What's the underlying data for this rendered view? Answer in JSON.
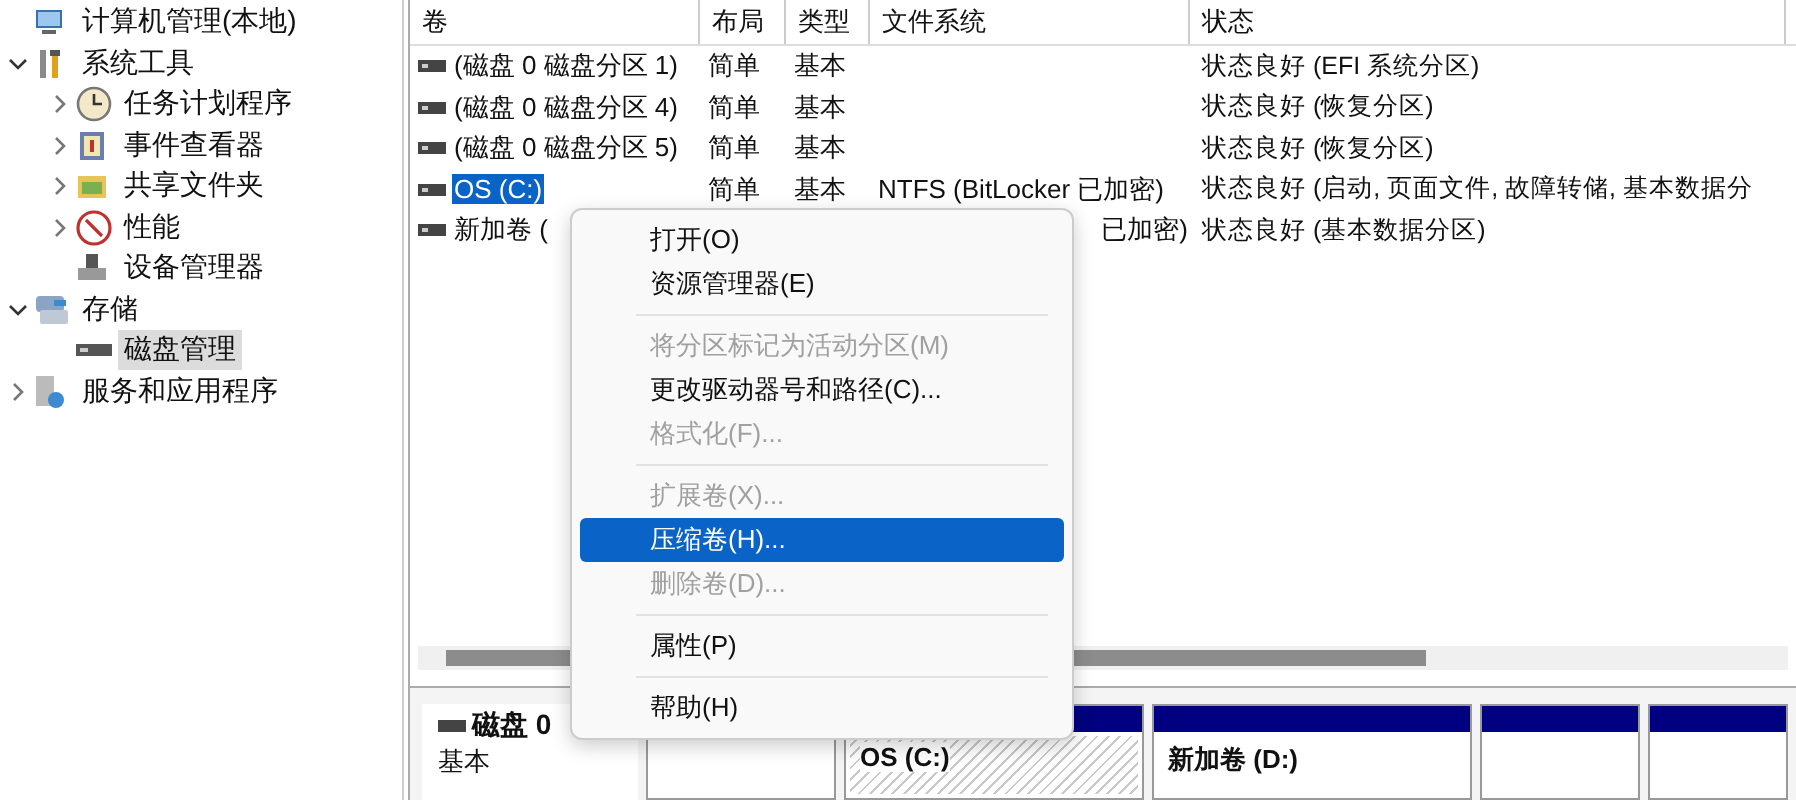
{
  "tree": [
    {
      "label": "计算机管理(本地)",
      "selected": false,
      "children": [
        {
          "label": "系统工具",
          "expanded": true,
          "selected": false,
          "children": [
            {
              "label": "任务计划程序",
              "expanded": false,
              "selected": false
            },
            {
              "label": "事件查看器",
              "expanded": false,
              "selected": false
            },
            {
              "label": "共享文件夹",
              "expanded": false,
              "selected": false
            },
            {
              "label": "性能",
              "expanded": false,
              "selected": false
            },
            {
              "label": "设备管理器",
              "selected": false
            }
          ]
        },
        {
          "label": "存储",
          "expanded": true,
          "selected": false,
          "children": [
            {
              "label": "磁盘管理",
              "selected": true
            }
          ]
        },
        {
          "label": "服务和应用程序",
          "expanded": false,
          "selected": false
        }
      ]
    }
  ],
  "table": {
    "columns": [
      "卷",
      "布局",
      "类型",
      "文件系统",
      "状态"
    ],
    "rows": [
      {
        "volume": "(磁盘 0 磁盘分区 1)",
        "layout": "简单",
        "type": "基本",
        "status": "状态良好 (EFI 系统分区)",
        "selected": false
      },
      {
        "volume": "(磁盘 0 磁盘分区 4)",
        "layout": "简单",
        "type": "基本",
        "status": "状态良好 (恢复分区)",
        "selected": false
      },
      {
        "volume": "(磁盘 0 磁盘分区 5)",
        "layout": "简单",
        "type": "基本",
        "status": "状态良好 (恢复分区)",
        "selected": false
      },
      {
        "volume": "OS (C:)",
        "layout": "简单",
        "type": "基本",
        "filesystem": "NTFS (BitLocker 已加密)",
        "status": "状态良好 (启动, 页面文件, 故障转储, 基本数据分",
        "selected": true
      },
      {
        "volume": "新加卷 (",
        "filesystem": "已加密)",
        "status": "状态良好 (基本数据分区)",
        "selected": false
      }
    ]
  },
  "disk": {
    "name": "磁盘 0",
    "type": "基本",
    "partitions": [
      {
        "selected": false
      },
      {
        "label": "OS (C:)",
        "selected": true
      },
      {
        "label": "新加卷 (D:)",
        "selected": false
      },
      {
        "selected": false
      },
      {
        "selected": false
      }
    ]
  },
  "context_menu": [
    {
      "kind": "item",
      "label": "打开(O)",
      "disabled": false,
      "selected": false
    },
    {
      "kind": "item",
      "label": "资源管理器(E)",
      "disabled": false,
      "selected": false
    },
    {
      "kind": "separator"
    },
    {
      "kind": "item",
      "label": "将分区标记为活动分区(M)",
      "disabled": true,
      "selected": false
    },
    {
      "kind": "item",
      "label": "更改驱动器号和路径(C)...",
      "disabled": false,
      "selected": false
    },
    {
      "kind": "item",
      "label": "格式化(F)...",
      "disabled": true,
      "selected": false
    },
    {
      "kind": "separator"
    },
    {
      "kind": "item",
      "label": "扩展卷(X)...",
      "disabled": true,
      "selected": false
    },
    {
      "kind": "item",
      "label": "压缩卷(H)...",
      "disabled": false,
      "selected": true
    },
    {
      "kind": "item",
      "label": "删除卷(D)...",
      "disabled": true,
      "selected": false
    },
    {
      "kind": "separator"
    },
    {
      "kind": "item",
      "label": "属性(P)",
      "disabled": false,
      "selected": false
    },
    {
      "kind": "separator"
    },
    {
      "kind": "item",
      "label": "帮助(H)",
      "disabled": false,
      "selected": false
    }
  ]
}
